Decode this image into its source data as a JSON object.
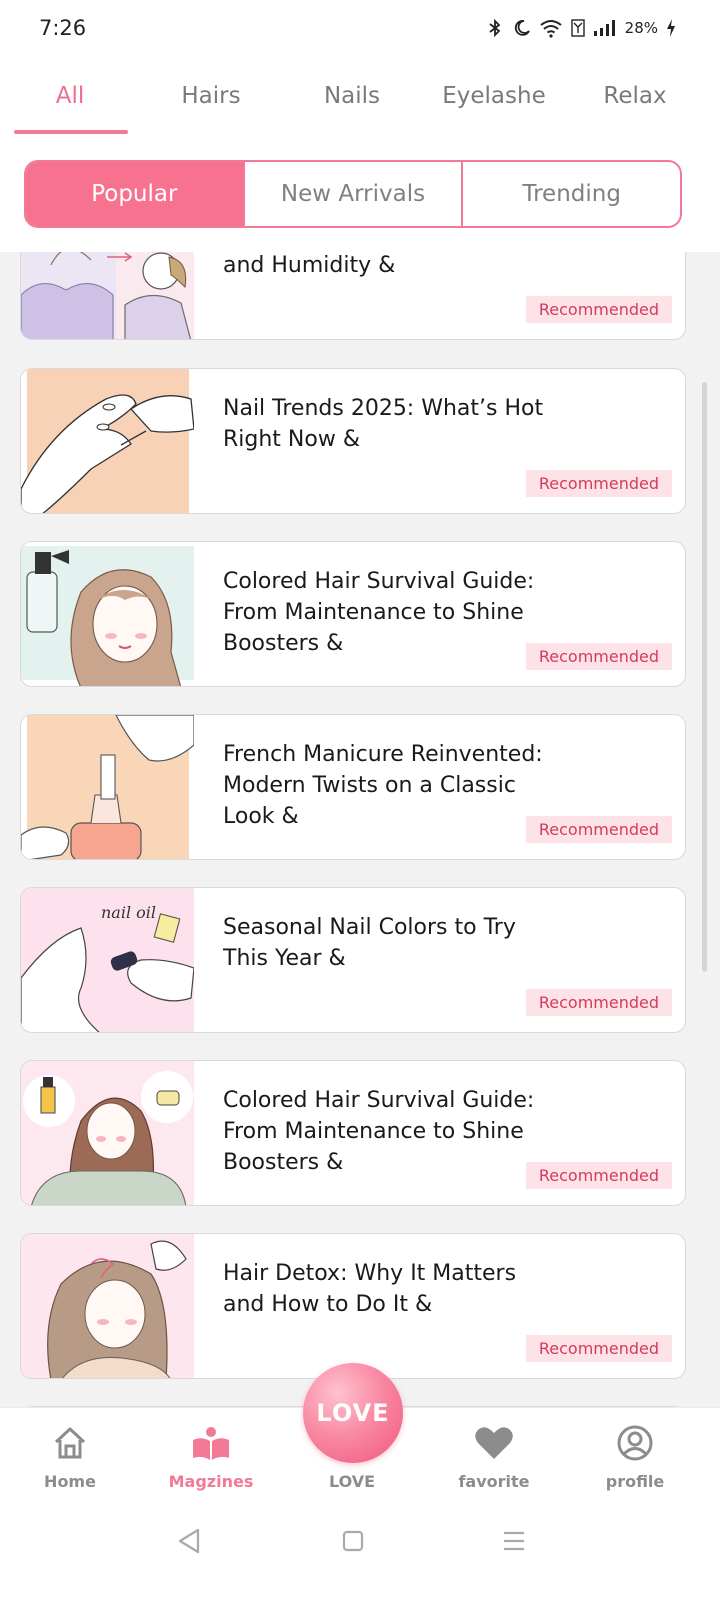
{
  "status_bar": {
    "time": "7:26",
    "battery": "28%"
  },
  "top_tabs": [
    {
      "label": "All",
      "active": true
    },
    {
      "label": "Hairs",
      "active": false
    },
    {
      "label": "Nails",
      "active": false
    },
    {
      "label": "Eyelashe",
      "active": false
    },
    {
      "label": "Relax",
      "active": false
    }
  ],
  "segments": [
    {
      "label": "Popular",
      "active": true
    },
    {
      "label": "New Arrivals",
      "active": false
    },
    {
      "label": "Trending",
      "active": false
    }
  ],
  "articles": [
    {
      "title": "Protect Your Hair From Sun and Humidity &",
      "badge": "Recommended",
      "thumb": "hair-lavender"
    },
    {
      "title": "Nail Trends 2025: What’s Hot Right Now &",
      "badge": "Recommended",
      "thumb": "nail-peach"
    },
    {
      "title": "Colored Hair Survival Guide: From Maintenance to Shine Boosters &",
      "badge": "Recommended",
      "thumb": "hair-spray"
    },
    {
      "title": "French Manicure Reinvented: Modern Twists on a Classic Look &",
      "badge": "Recommended",
      "thumb": "nail-polish"
    },
    {
      "title": "Seasonal Nail Colors to Try This Year &",
      "badge": "Recommended",
      "thumb": "nail-oil"
    },
    {
      "title": "Colored Hair Survival Guide: From Maintenance to Shine Boosters &",
      "badge": "Recommended",
      "thumb": "hair-bottles"
    },
    {
      "title": "Hair Detox: Why It Matters and How to Do It &",
      "badge": "Recommended",
      "thumb": "hair-detox"
    }
  ],
  "thumb_text": {
    "nail_oil": "nail oil"
  },
  "bottom_nav": {
    "home": "Home",
    "magazines": "Magzines",
    "love": "LOVE",
    "favorite": "favorite",
    "profile": "profile",
    "fab_label": "LOVE"
  },
  "colors": {
    "accent": "#f27a96",
    "accent_fill": "#f7728f",
    "badge_bg": "#fde3e8",
    "badge_text": "#d63a5b"
  }
}
